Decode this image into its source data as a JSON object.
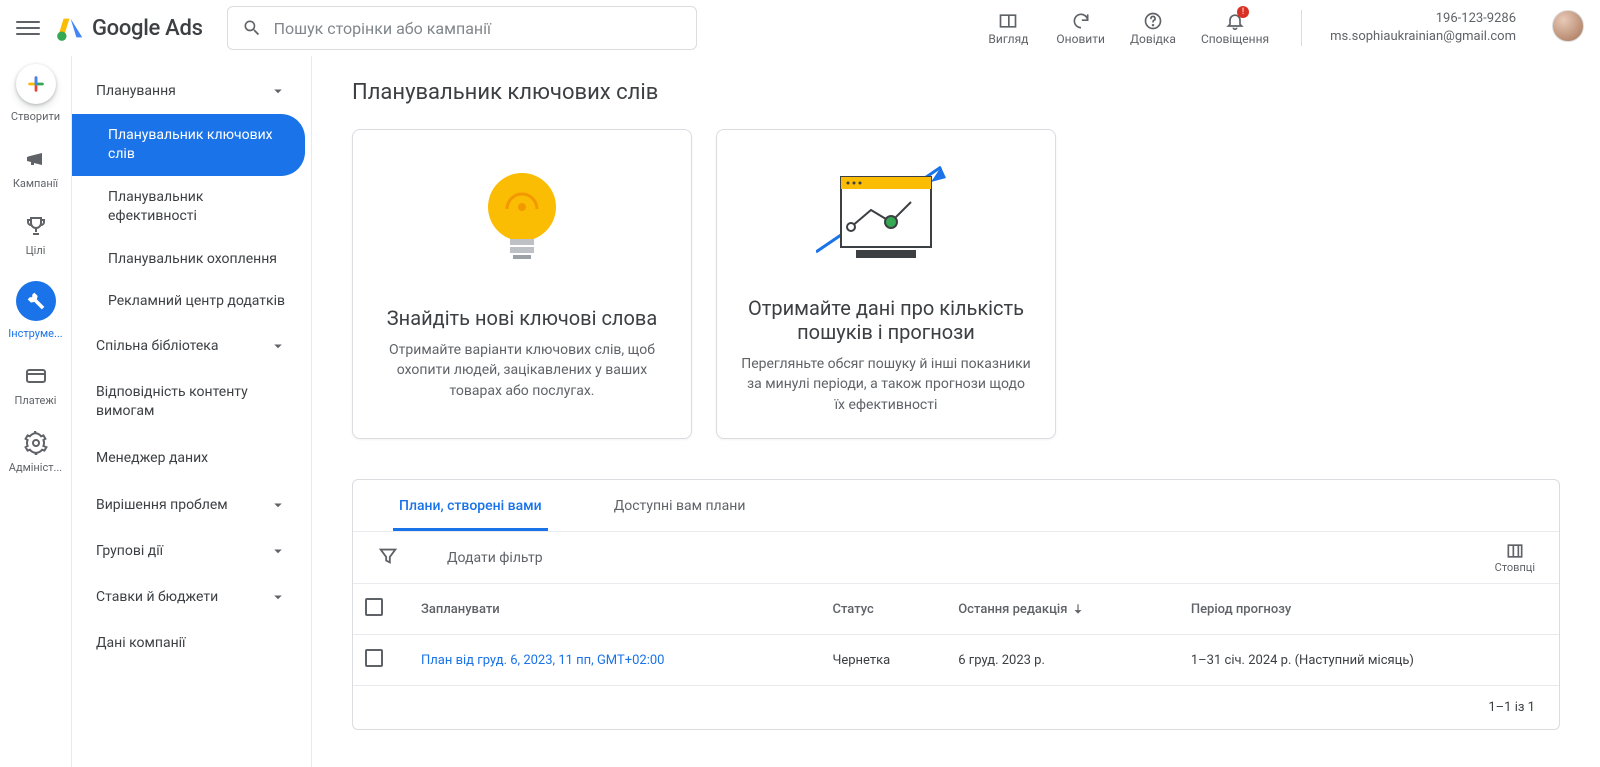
{
  "header": {
    "logo": "Google Ads",
    "search_placeholder": "Пошук сторінки або кампанії",
    "actions": {
      "appearance": "Вигляд",
      "refresh": "Оновити",
      "help": "Довідка",
      "notifications": "Сповіщення"
    },
    "account_id": "196-123-9286",
    "account_email": "ms.sophiaukrainian@gmail.com"
  },
  "rail": {
    "create": "Створити",
    "campaigns": "Кампанії",
    "goals": "Цілі",
    "tools": "Інструме...",
    "billing": "Платежі",
    "admin": "Адмініст..."
  },
  "secnav": {
    "planning": {
      "header": "Планування",
      "keyword_planner": "Планувальник ключових слів",
      "performance_planner": "Планувальник ефективності",
      "reach_planner": "Планувальник охоплення",
      "app_ads_hub": "Рекламний центр додатків"
    },
    "shared_library": "Спільна бібліотека",
    "content_suitability": "Відповідність контенту вимогам",
    "data_manager": "Менеджер даних",
    "troubleshooting": "Вирішення проблем",
    "bulk_actions": "Групові дії",
    "budgets_bids": "Ставки й бюджети",
    "business_data": "Дані компанії"
  },
  "page": {
    "title": "Планувальник ключових слів",
    "card1_title": "Знайдіть нові ключові слова",
    "card1_desc": "Отримайте варіанти ключових слів, щоб охопити людей, зацікавлених у ваших товарах або послугах.",
    "card2_title": "Отримайте дані про кількість пошуків і прогнози",
    "card2_desc": "Перегляньте обсяг пошуку й інші показники за минулі періоди, а також прогнози щодо їх ефективності"
  },
  "plans": {
    "tab_created": "Плани, створені вами",
    "tab_shared": "Доступні вам плани",
    "add_filter": "Додати фільтр",
    "columns_label": "Стовпці",
    "th_plan": "Запланувати",
    "th_status": "Статус",
    "th_last_edit": "Остання редакція",
    "th_forecast": "Період прогнозу",
    "row1_plan": "План від груд. 6, 2023, 11 пп, GMT+02:00",
    "row1_status": "Чернетка",
    "row1_last_edit": "6 груд. 2023 р.",
    "row1_forecast": "1–31 січ. 2024 р. (Наступний місяць)",
    "pager": "1–1 із 1"
  }
}
